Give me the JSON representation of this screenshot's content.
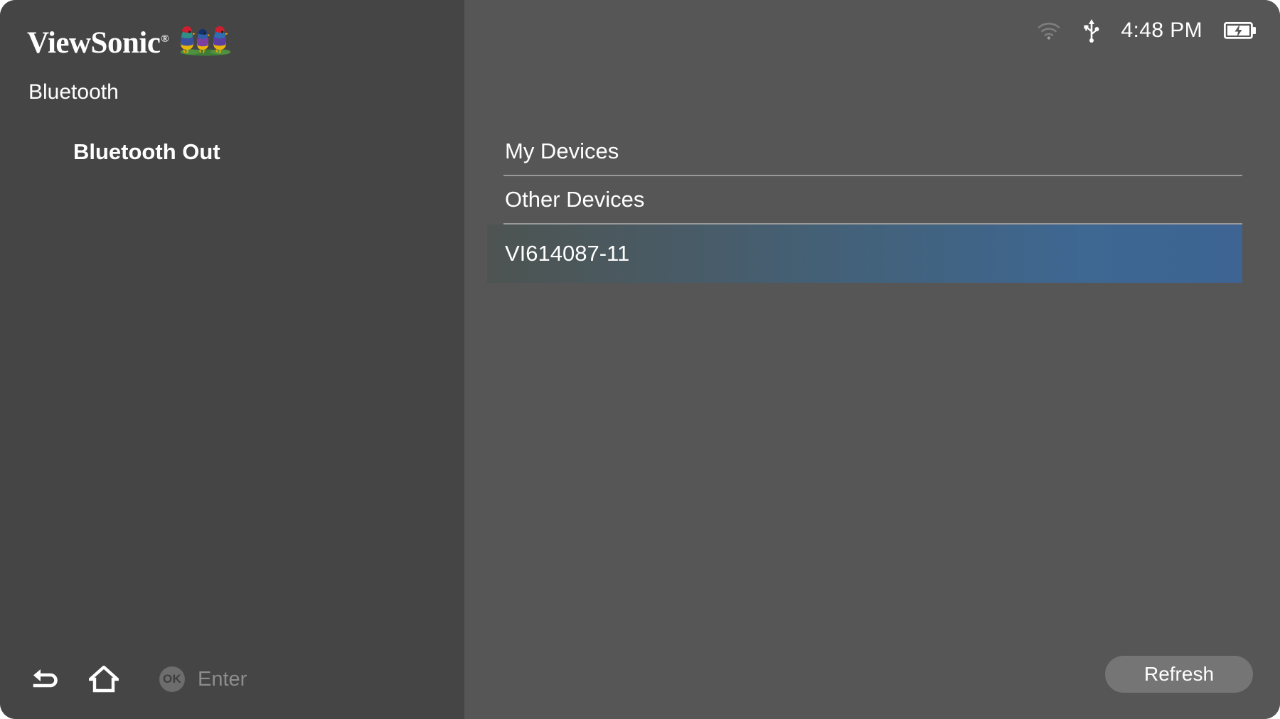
{
  "brand": {
    "name": "ViewSonic",
    "registered_mark": "®",
    "logo_icon": "viewsonic-finches-logo"
  },
  "sidebar": {
    "title": "Bluetooth",
    "selected_item": "Bluetooth Out",
    "key_hints": [
      {
        "icon": "back-arrow-icon",
        "label": ""
      },
      {
        "icon": "home-icon",
        "label": ""
      },
      {
        "icon": "ok-button-icon",
        "badge": "OK",
        "label": "Enter"
      }
    ]
  },
  "statusbar": {
    "wifi_icon": "wifi-icon",
    "usb_icon": "usb-icon",
    "time": "4:48 PM",
    "battery_icon": "battery-charging-icon"
  },
  "main": {
    "sections": [
      {
        "title": "My Devices",
        "devices": []
      },
      {
        "title": "Other Devices",
        "devices": [
          {
            "name": "VI614087-11",
            "selected": true
          }
        ]
      }
    ],
    "refresh_label": "Refresh"
  },
  "colors": {
    "sidebar_bg": "#454545",
    "panel_bg": "#565656",
    "selection_blue": "#3d6493",
    "divider": "#9a9a9a",
    "muted_text": "#8d8d8d",
    "button_bg": "#757575"
  }
}
